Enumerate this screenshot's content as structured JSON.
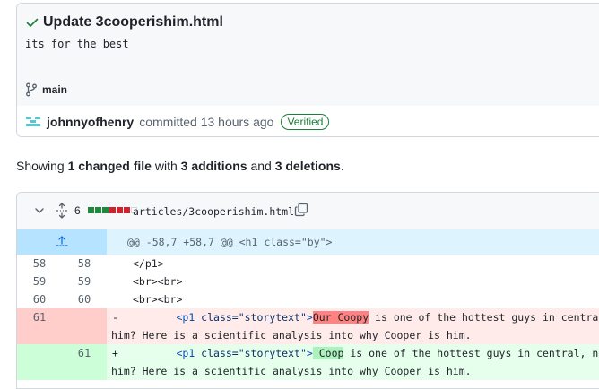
{
  "commit": {
    "title": "Update 3cooperishim.html",
    "description": "its for the best",
    "branch": "main",
    "author": "johnnyofhenry",
    "committed_text": "committed 13 hours ago",
    "verified_label": "Verified"
  },
  "summary": {
    "prefix": "Showing",
    "changed_files": "1 changed file",
    "with": "with",
    "additions": "3 additions",
    "and": "and",
    "deletions": "3 deletions",
    "period": "."
  },
  "file": {
    "changes": "6",
    "diffstat": [
      "add",
      "add",
      "add",
      "del",
      "del",
      "del",
      "neutral"
    ],
    "path": "articles/3cooperishim.html",
    "hunk_header": "@@ -58,7 +58,7 @@ <h1 class=\"by\">",
    "lines": [
      {
        "old": "58",
        "new": "58",
        "sign": "",
        "code": "</p1>"
      },
      {
        "old": "59",
        "new": "59",
        "sign": "",
        "code": "<br><br>"
      },
      {
        "old": "60",
        "new": "60",
        "sign": "",
        "code": "<br><br>"
      }
    ],
    "deleted": {
      "old": "61",
      "sign": "-",
      "indent": "       ",
      "tag_open": "<p1 ",
      "attr": "class=\"storytext\"",
      "tag_close": ">",
      "highlight": "Our Coopy",
      "rest": " is one of the hottest guys in central, no",
      "continuation": "him? Here is a scientific analysis into why Cooper is him."
    },
    "added": {
      "new": "61",
      "sign": "+",
      "indent": "       ",
      "tag_open": "<p1 ",
      "attr": "class=\"storytext\"",
      "tag_close": ">",
      "highlight": " Coop",
      "rest": " is one of the hottest guys in central, no won",
      "continuation": "him? Here is a scientific analysis into why Cooper is him."
    }
  },
  "colors": {
    "accent_green": "#1a7f37",
    "deletion_red": "#cf222e",
    "hunk_blue": "#ddf4ff"
  }
}
